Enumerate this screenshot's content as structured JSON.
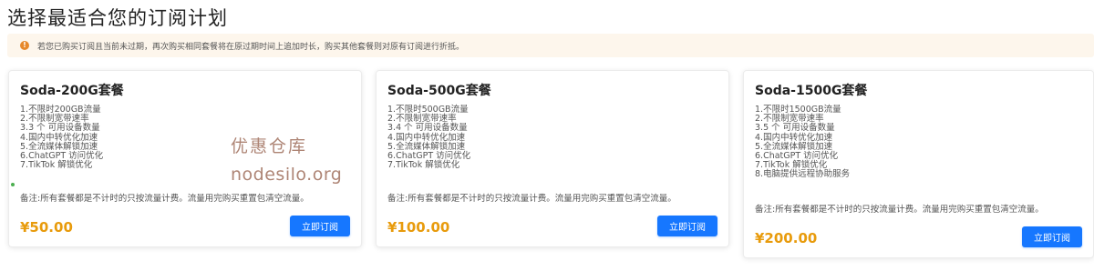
{
  "page": {
    "title": "选择最适合您的订阅计划"
  },
  "notice": {
    "icon": "warning-circle-icon",
    "text": "若您已购买订阅且当前未过期，再次购买相同套餐将在原过期时间上追加时长，购买其他套餐则对原有订阅进行折抵。"
  },
  "plans": [
    {
      "name": "Soda-200G套餐",
      "features": [
        "1.不限时200GB流量",
        "2.不限制宽带速率",
        "3.3 个 可用设备数量",
        "4.国内中转优化加速",
        "5.全流媒体解锁加速",
        "6.ChatGPT 访问优化",
        "7.TikTok 解锁优化"
      ],
      "remark": "备注:所有套餐都是不计时的只按流量计费。流量用完购买重置包清空流量。",
      "price": "¥50.00",
      "button": "立即订阅"
    },
    {
      "name": "Soda-500G套餐",
      "features": [
        "1.不限时500GB流量",
        "2.不限制宽带速率",
        "3.4 个 可用设备数量",
        "4.国内中转优化加速",
        "5.全流媒体解锁加速",
        "6.ChatGPT 访问优化",
        "7.TikTok 解锁优化"
      ],
      "remark": "备注:所有套餐都是不计时的只按流量计费。流量用完购买重置包清空流量。",
      "price": "¥100.00",
      "button": "立即订阅"
    },
    {
      "name": "Soda-1500G套餐",
      "features": [
        "1.不限时1500GB流量",
        "2.不限制宽带速率",
        "3.5 个 可用设备数量",
        "4.国内中转优化加速",
        "5.全流媒体解锁加速",
        "6.ChatGPT 访问优化",
        "7.TikTok 解锁优化",
        "8.电脑提供远程协助服务"
      ],
      "remark": "备注:所有套餐都是不计时的只按流量计费。流量用完购买重置包清空流量。",
      "price": "¥200.00",
      "button": "立即订阅"
    }
  ],
  "watermark": {
    "line1": "优惠仓库",
    "line2": "nodesilo.org"
  },
  "colors": {
    "primary": "#1677ff",
    "price": "#e89b0c",
    "notice_bg": "#fdf6ec",
    "warning": "#e6882b"
  }
}
